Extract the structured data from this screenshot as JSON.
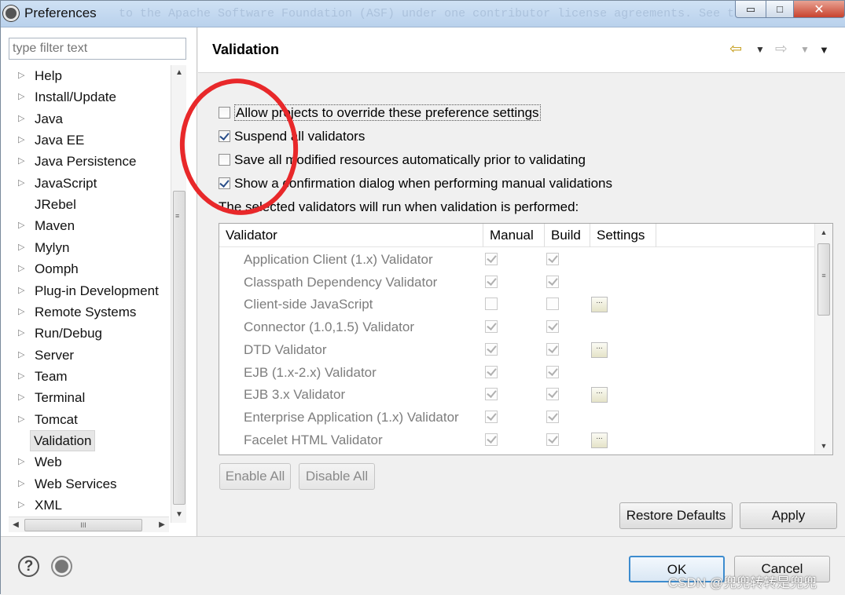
{
  "window": {
    "title": "Preferences",
    "background_text": "to the Apache Software Foundation (ASF) under one   contributor license agreements.  See the NOTICE file",
    "minimize_glyph": "▭",
    "maximize_glyph": "□",
    "close_glyph": "✕"
  },
  "filter": {
    "placeholder": "type filter text"
  },
  "tree": {
    "items": [
      {
        "label": "Help",
        "expandable": true
      },
      {
        "label": "Install/Update",
        "expandable": true
      },
      {
        "label": "Java",
        "expandable": true
      },
      {
        "label": "Java EE",
        "expandable": true
      },
      {
        "label": "Java Persistence",
        "expandable": true
      },
      {
        "label": "JavaScript",
        "expandable": true
      },
      {
        "label": "JRebel",
        "expandable": false
      },
      {
        "label": "Maven",
        "expandable": true
      },
      {
        "label": "Mylyn",
        "expandable": true
      },
      {
        "label": "Oomph",
        "expandable": true
      },
      {
        "label": "Plug-in Development",
        "expandable": true
      },
      {
        "label": "Remote Systems",
        "expandable": true
      },
      {
        "label": "Run/Debug",
        "expandable": true
      },
      {
        "label": "Server",
        "expandable": true
      },
      {
        "label": "Team",
        "expandable": true
      },
      {
        "label": "Terminal",
        "expandable": true
      },
      {
        "label": "Tomcat",
        "expandable": true
      },
      {
        "label": "Validation",
        "expandable": false,
        "selected": true
      },
      {
        "label": "Web",
        "expandable": true
      },
      {
        "label": "Web Services",
        "expandable": true
      },
      {
        "label": "XML",
        "expandable": true
      }
    ],
    "arrow_glyph": "▷"
  },
  "page": {
    "title": "Validation",
    "nav": {
      "back": "⇦",
      "forward": "⇨",
      "dropdown": "▼",
      "menu": "▼"
    }
  },
  "options": {
    "allow_override": {
      "label": "Allow projects to override these preference settings",
      "checked": false
    },
    "suspend_all": {
      "label": "Suspend all validators",
      "checked": true
    },
    "save_all": {
      "label": "Save all modified resources automatically prior to validating",
      "checked": false
    },
    "confirm_dialog": {
      "label": "Show a confirmation dialog when performing manual validations",
      "checked": true
    }
  },
  "note": "The selected validators will run when validation is performed:",
  "validators": {
    "columns": [
      "Validator",
      "Manual",
      "Build",
      "Settings"
    ],
    "rows": [
      {
        "name": "Application Client (1.x) Validator",
        "manual": true,
        "build": true,
        "settings": false
      },
      {
        "name": "Classpath Dependency Validator",
        "manual": true,
        "build": true,
        "settings": false
      },
      {
        "name": "Client-side JavaScript",
        "manual": false,
        "build": false,
        "settings": true
      },
      {
        "name": "Connector (1.0,1.5) Validator",
        "manual": true,
        "build": true,
        "settings": false
      },
      {
        "name": "DTD Validator",
        "manual": true,
        "build": true,
        "settings": true
      },
      {
        "name": "EJB (1.x-2.x) Validator",
        "manual": true,
        "build": true,
        "settings": false
      },
      {
        "name": "EJB 3.x Validator",
        "manual": true,
        "build": true,
        "settings": true
      },
      {
        "name": "Enterprise Application (1.x) Validator",
        "manual": true,
        "build": true,
        "settings": false
      },
      {
        "name": "Facelet HTML Validator",
        "manual": true,
        "build": true,
        "settings": true
      }
    ],
    "settings_glyph": "..."
  },
  "buttons": {
    "enable_all": "Enable All",
    "disable_all": "Disable All",
    "restore_defaults": "Restore Defaults",
    "apply": "Apply",
    "ok": "OK",
    "cancel": "Cancel"
  },
  "footer": {
    "help_glyph": "?",
    "watermark": "CSDN @兜兜转转是兜兜"
  },
  "colors": {
    "annotation": "#e8282a",
    "accent": "#3d8ccf"
  }
}
